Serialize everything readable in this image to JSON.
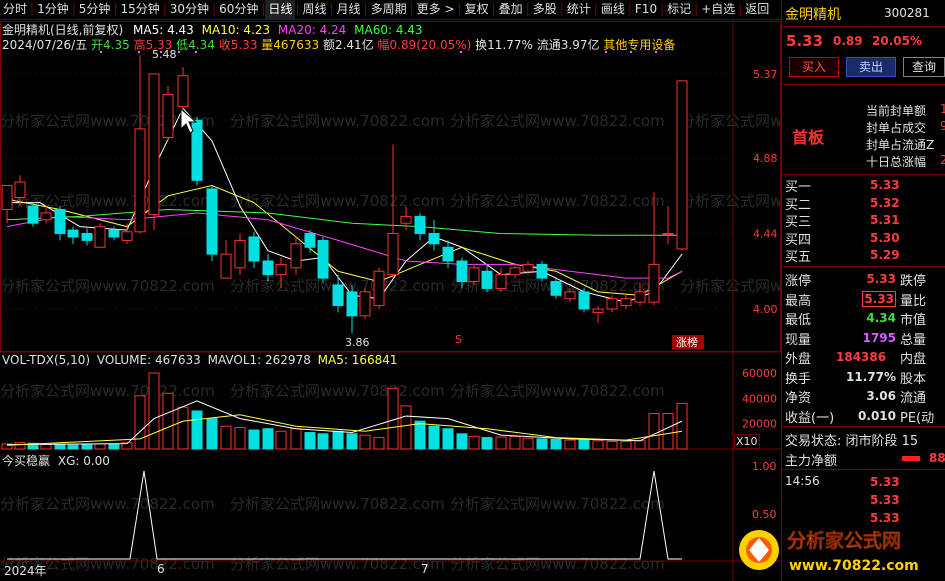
{
  "toolbar": {
    "items": [
      "分时",
      "1分钟",
      "5分钟",
      "15分钟",
      "30分钟",
      "60分钟",
      "日线",
      "周线",
      "月线",
      "多周期",
      "更多 >",
      "复权",
      "叠加",
      "多股",
      "统计",
      "画线",
      "F10",
      "标记",
      "+自选",
      "返回"
    ],
    "active": "日线"
  },
  "header": {
    "title": "金明精机(日线,前复权)",
    "ma5": "MA5: 4.43",
    "ma10": "MA10: 4.23",
    "ma20": "MA20: 4.24",
    "ma60": "MA60: 4.43",
    "date": "2024/07/26/五",
    "open": "开4.35",
    "high": "高5.33",
    "low": "低4.34",
    "close": "收5.33",
    "volume": "量467633",
    "amount": "额2.41亿",
    "change": "幅0.89(20.05%)",
    "turnover": "换11.77%",
    "float": "流通3.97亿",
    "sector": "其他专用设备"
  },
  "main": {
    "price_axis": [
      "5.37",
      "4.88",
      "4.44",
      "4.00"
    ],
    "high_marker": "5.48",
    "low_marker": "3.86",
    "limit_tag": "涨榜",
    "s_tag": "S",
    "watermark": "分析家公式网www.70822.com"
  },
  "volume_panel": {
    "title": "VOL-TDX(5,10)",
    "volume": "VOLUME: 467633",
    "mavol1": "MAVOL1: 262978",
    "ma5": "MA5: 166841",
    "axis": [
      "60000",
      "40000",
      "20000"
    ],
    "unit": "X10"
  },
  "indicator_panel": {
    "title": "今买稳赢",
    "xg": "XG: 0.00",
    "axis": [
      "1.00",
      "0.50"
    ]
  },
  "date_axis": {
    "year": "2024年",
    "m1": "6",
    "m2": "7"
  },
  "right_panel": {
    "name": "金明精机",
    "code": "300281",
    "price": "5.33",
    "change": "0.89",
    "pct": "20.05%",
    "buy_btn": "买入",
    "sell_btn": "卖出",
    "query_btn": "查询",
    "seal_title": "首板",
    "seal_rows": [
      {
        "label": "当前封单额",
        "value": "1"
      },
      {
        "label": "封单占成交",
        "value": "9"
      },
      {
        "label": "封单占流通Z",
        "value": ""
      },
      {
        "label": "十日总涨幅",
        "value": "2"
      }
    ],
    "quotes": [
      {
        "label": "买一",
        "price": "5.33"
      },
      {
        "label": "买二",
        "price": "5.32"
      },
      {
        "label": "买三",
        "price": "5.31"
      },
      {
        "label": "买四",
        "price": "5.30"
      },
      {
        "label": "买五",
        "price": "5.29"
      }
    ],
    "stats": [
      {
        "label": "涨停",
        "value": "5.33",
        "label2": "跌停"
      },
      {
        "label": "最高",
        "value": "5.33",
        "label2": "量比"
      },
      {
        "label": "最低",
        "value": "4.34",
        "label2": "市值"
      },
      {
        "label": "现量",
        "value": "1795",
        "label2": "总量"
      },
      {
        "label": "外盘",
        "value": "184386",
        "label2": "内盘"
      },
      {
        "label": "换手",
        "value": "11.77%",
        "label2": "股本"
      },
      {
        "label": "净资",
        "value": "3.06",
        "label2": "流通"
      },
      {
        "label": "收益(一)",
        "value": "0.010",
        "label2": "PE(动"
      }
    ],
    "trade_status": "交易状态: 闭市阶段 15",
    "flow_title": "主力净额",
    "flow_value": "88",
    "tick_time": "14:56",
    "ticks": [
      "5.33",
      "5.33",
      "5.33"
    ],
    "logo_text": "分析家公式网",
    "logo_url": "www.70822.com"
  }
}
